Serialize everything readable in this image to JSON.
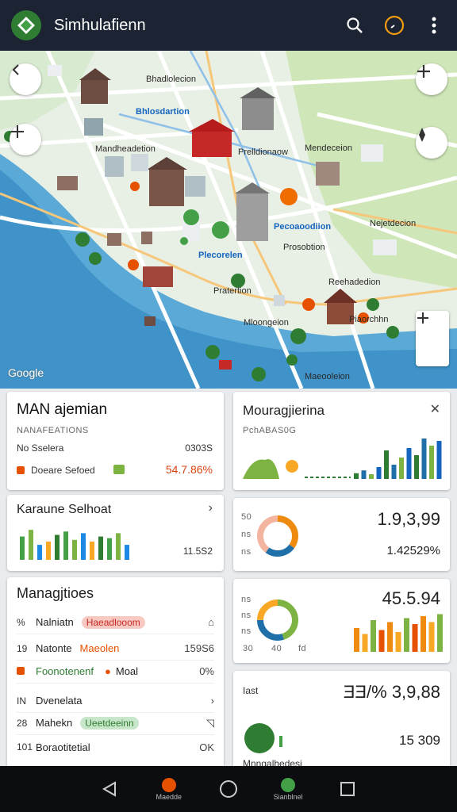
{
  "app": {
    "title": "Simhulafienn"
  },
  "map": {
    "labels": [
      "Bhadlolecion",
      "Bhlosdartion",
      "Mandheadetion",
      "Prelldionaow",
      "Mendeceion",
      "Nejetdecion",
      "Pecoaoodiion",
      "Plecorelen",
      "Prosobtion",
      "Reehadedion",
      "Pratertion",
      "Mloongeion",
      "Piaorchhn",
      "Maeooleion"
    ],
    "attribution": "Google"
  },
  "card_management": {
    "title": "MAN ajemian",
    "subtitle": "NANAFEATIONS",
    "row1_label": "No Sselera",
    "row1_value": "0303S",
    "row2_label": "Doeare Sefoed",
    "row2_value": "54.7.86%"
  },
  "card_mouragiering": {
    "title": "Mouragjierina",
    "subtitle": "PchABAS0G",
    "bars": [
      0.12,
      0.18,
      0.1,
      0.25,
      0.6,
      0.3,
      0.45,
      0.65,
      0.5,
      0.85,
      0.7,
      0.8
    ]
  },
  "card_school": {
    "title": "Karaune Selhoat",
    "value": "11.5S2",
    "bars": [
      0.7,
      0.9,
      0.45,
      0.55,
      0.75,
      0.85,
      0.6,
      0.8,
      0.55,
      0.7,
      0.65,
      0.8,
      0.45
    ]
  },
  "card_donut1": {
    "value": "1.9,3,99",
    "percent": "1.42529%",
    "side_labels": [
      "50",
      "ns",
      "ns"
    ],
    "segments": [
      0.35,
      0.25,
      0.4
    ]
  },
  "card_managtiees": {
    "title": "Managjtioes",
    "rows": [
      {
        "num": "%",
        "label": "Nalniatn",
        "badge": "Haeadlooom",
        "icon": "⌂"
      },
      {
        "num": "19",
        "label": "Natonte",
        "extra": "Maeolen",
        "right": "159S6"
      },
      {
        "num": "",
        "label": "Foonotenenf",
        "extra": "Moal",
        "right": "0%"
      },
      {
        "num": "IN",
        "label": "Dvenelata",
        "right": "›"
      },
      {
        "num": "28",
        "label": "Mahekn",
        "badge": "Ueetdeeinn",
        "icon": "◹"
      },
      {
        "num": "101",
        "label": "Boraotitetial",
        "right": "OK"
      }
    ]
  },
  "card_donut2": {
    "value": "45.5.94",
    "side_labels": [
      "ns",
      "ns",
      "ns"
    ],
    "axis": [
      "30",
      "40",
      "fd"
    ],
    "bars": [
      0.6,
      0.45,
      0.8,
      0.55,
      0.75,
      0.5,
      0.85,
      0.7,
      0.9,
      0.75,
      0.95
    ]
  },
  "card_last": {
    "label": "Iast",
    "headline": "ƎƎ/%  3,9,88",
    "value": "15 309",
    "caption": "Mnngalhedesi"
  },
  "bottom_nav": {
    "items": [
      "Maedde",
      "",
      "Sianblnel",
      ""
    ]
  }
}
